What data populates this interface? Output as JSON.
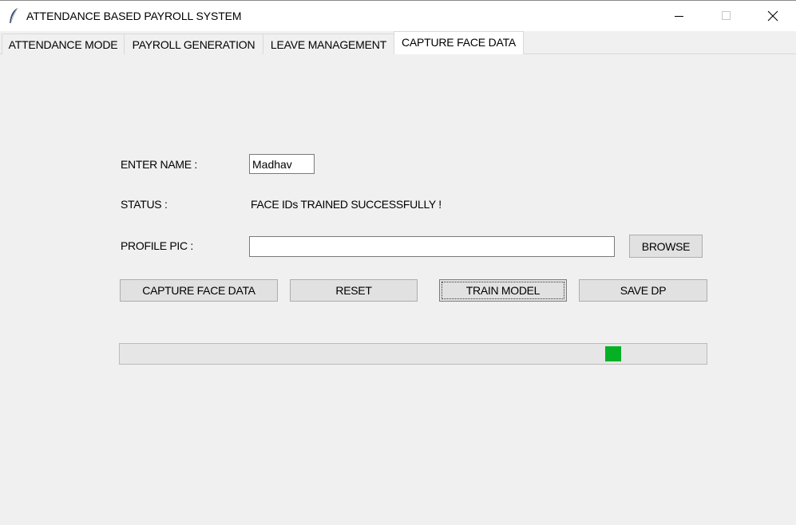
{
  "window": {
    "title": "ATTENDANCE BASED PAYROLL SYSTEM",
    "app_icon": "feather-icon",
    "controls": [
      "minimize-icon",
      "maximize-icon",
      "close-icon"
    ]
  },
  "tabs": [
    {
      "label": "ATTENDANCE MODE",
      "active": false
    },
    {
      "label": "PAYROLL GENERATION",
      "active": false
    },
    {
      "label": "LEAVE MANAGEMENT",
      "active": false
    },
    {
      "label": "CAPTURE FACE DATA",
      "active": true
    }
  ],
  "form": {
    "name_label": "ENTER NAME :",
    "name_value": "Madhav",
    "status_label": "STATUS :",
    "status_value": "FACE IDs TRAINED SUCCESSFULLY !",
    "profile_label": "PROFILE PIC :",
    "profile_value": "",
    "browse_label": "BROWSE"
  },
  "actions": {
    "capture_label": "CAPTURE FACE DATA",
    "reset_label": "RESET",
    "train_label": "TRAIN MODEL",
    "save_label": "SAVE DP"
  },
  "progress": {
    "mode": "indeterminate",
    "position_fraction": 0.85,
    "color": "#06b025"
  }
}
